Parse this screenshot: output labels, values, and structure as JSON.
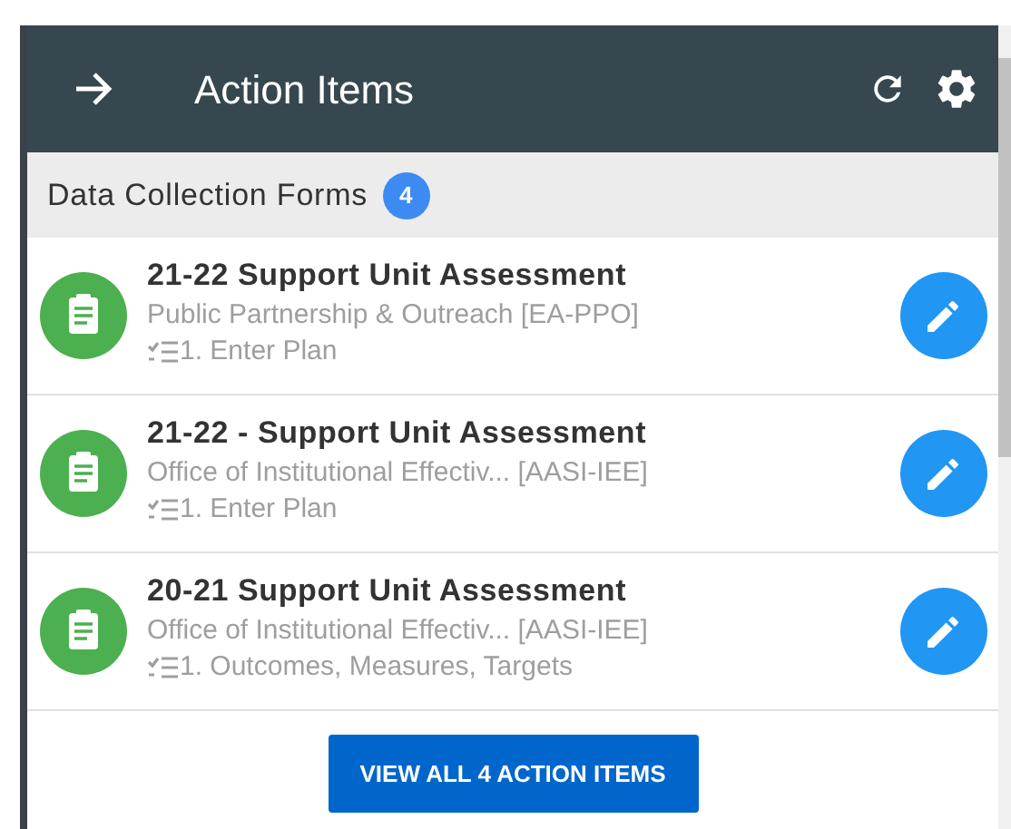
{
  "header": {
    "title": "Action Items"
  },
  "section": {
    "title": "Data Collection Forms",
    "count": "4"
  },
  "items": [
    {
      "title": "21-22 Support Unit Assessment",
      "unit": "Public Partnership & Outreach [EA-PPO]",
      "step": "1. Enter Plan"
    },
    {
      "title": "21-22 - Support Unit Assessment",
      "unit": "Office of Institutional Effectiv... [AASI-IEE]",
      "step": "1. Enter Plan"
    },
    {
      "title": "20-21 Support Unit Assessment",
      "unit": "Office of Institutional Effectiv... [AASI-IEE]",
      "step": "1. Outcomes, Measures, Targets"
    }
  ],
  "footer": {
    "button": "VIEW ALL 4 ACTION ITEMS"
  }
}
